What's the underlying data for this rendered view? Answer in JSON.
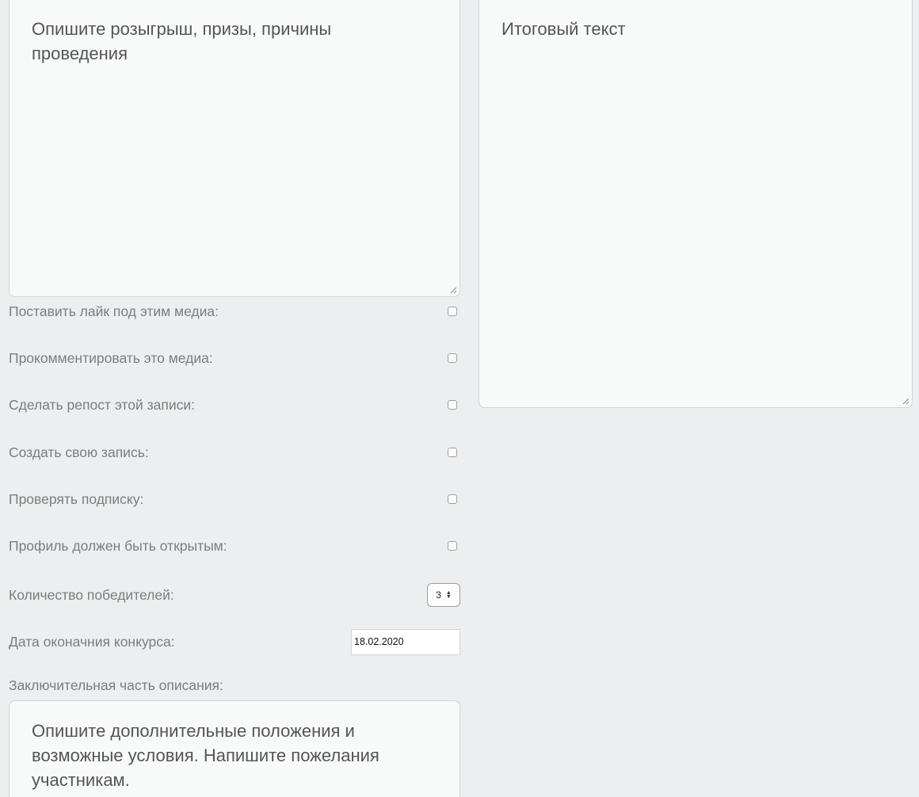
{
  "description": {
    "placeholder": "Опишите розыгрыш, призы, причины проведения"
  },
  "result": {
    "placeholder": "Итоговый текст"
  },
  "options": [
    {
      "label": "Поставить лайк под этим медиа:",
      "checked": false
    },
    {
      "label": "Прокомментировать это медиа:",
      "checked": false
    },
    {
      "label": "Сделать репост этой записи:",
      "checked": false
    },
    {
      "label": "Создать свою запись:",
      "checked": false
    },
    {
      "label": "Проверять подписку:",
      "checked": false
    },
    {
      "label": "Профиль должен быть открытым:",
      "checked": false
    }
  ],
  "winners": {
    "label": "Количество победителей:",
    "value": "3"
  },
  "end_date": {
    "label": "Дата оконачния конкурса:",
    "value": "18.02.2020"
  },
  "final_part": {
    "label": "Заключительная часть описания:",
    "placeholder": "Опишите дополнительные положения и возможные условия. Напишите пожелания участникам."
  }
}
